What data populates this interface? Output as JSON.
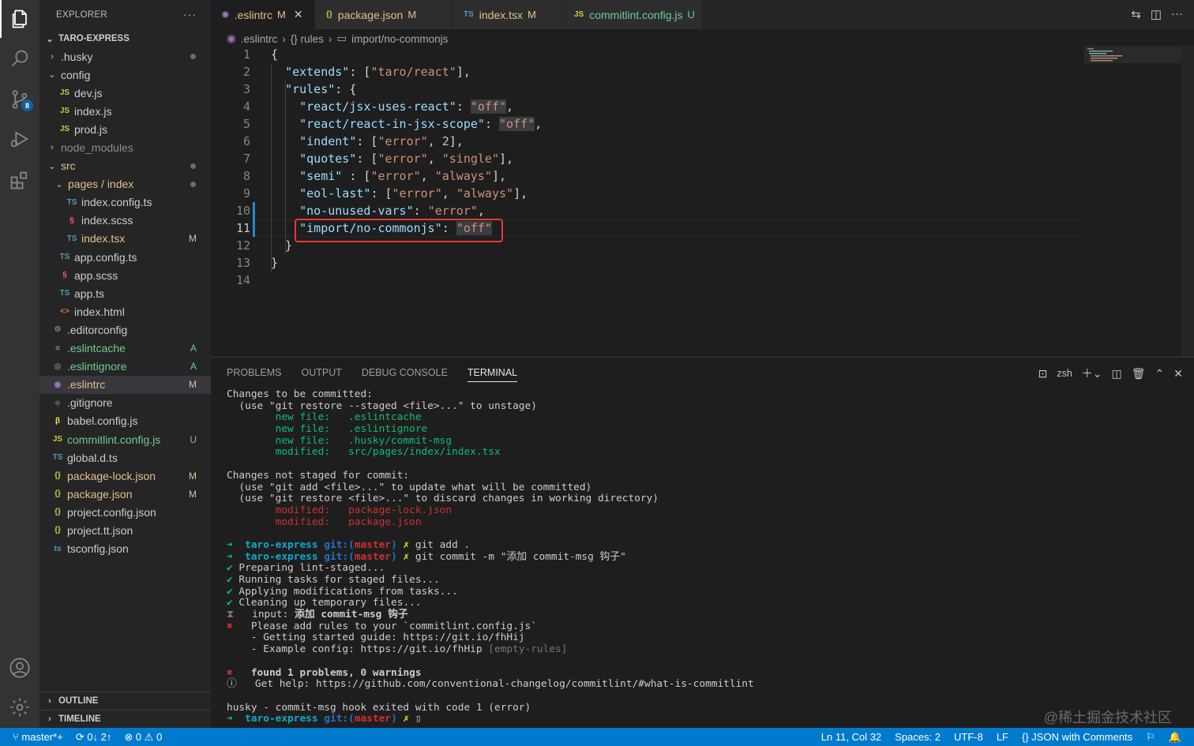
{
  "activity": {
    "scm_badge": "8"
  },
  "sidebar": {
    "title": "EXPLORER",
    "more": "···",
    "root": "TARO-EXPRESS",
    "items": [
      {
        "indent": 1,
        "chev": "›",
        "icon": "",
        "label": ".husky",
        "cls": "flabel",
        "status": "",
        "dot": true
      },
      {
        "indent": 1,
        "chev": "⌄",
        "icon": "",
        "label": "config",
        "cls": "flabel",
        "status": "",
        "dot": false
      },
      {
        "indent": 2,
        "chev": "",
        "icon": "JS",
        "iconcls": "ft-js",
        "label": "dev.js",
        "cls": "flabel",
        "status": ""
      },
      {
        "indent": 2,
        "chev": "",
        "icon": "JS",
        "iconcls": "ft-js",
        "label": "index.js",
        "cls": "flabel",
        "status": ""
      },
      {
        "indent": 2,
        "chev": "",
        "icon": "JS",
        "iconcls": "ft-js",
        "label": "prod.js",
        "cls": "flabel",
        "status": ""
      },
      {
        "indent": 1,
        "chev": "›",
        "icon": "",
        "label": "node_modules",
        "cls": "c-gray",
        "status": ""
      },
      {
        "indent": 1,
        "chev": "⌄",
        "icon": "",
        "label": "src",
        "cls": "c-yellow",
        "status": "",
        "dot": true
      },
      {
        "indent": 2,
        "chev": "⌄",
        "icon": "",
        "label": "pages / index",
        "cls": "c-yellow",
        "status": "",
        "dot": true
      },
      {
        "indent": 3,
        "chev": "",
        "icon": "TS",
        "iconcls": "ft-ts",
        "label": "index.config.ts",
        "cls": "flabel",
        "status": ""
      },
      {
        "indent": 3,
        "chev": "",
        "icon": "§",
        "iconcls": "ft-scss",
        "label": "index.scss",
        "cls": "flabel",
        "status": ""
      },
      {
        "indent": 3,
        "chev": "",
        "icon": "TS",
        "iconcls": "ft-ts",
        "label": "index.tsx",
        "cls": "c-yellow",
        "status": "M",
        "stcls": "c-yellow"
      },
      {
        "indent": 2,
        "chev": "",
        "icon": "TS",
        "iconcls": "ft-ts",
        "label": "app.config.ts",
        "cls": "flabel",
        "status": ""
      },
      {
        "indent": 2,
        "chev": "",
        "icon": "§",
        "iconcls": "ft-scss",
        "label": "app.scss",
        "cls": "flabel",
        "status": ""
      },
      {
        "indent": 2,
        "chev": "",
        "icon": "TS",
        "iconcls": "ft-ts",
        "label": "app.ts",
        "cls": "flabel",
        "status": ""
      },
      {
        "indent": 2,
        "chev": "",
        "icon": "<>",
        "iconcls": "ft-html",
        "label": "index.html",
        "cls": "flabel",
        "status": ""
      },
      {
        "indent": 1,
        "chev": "",
        "icon": "⚙",
        "iconcls": "ft-gear",
        "label": ".editorconfig",
        "cls": "flabel",
        "status": ""
      },
      {
        "indent": 1,
        "chev": "",
        "icon": "≡",
        "iconcls": "ft-lines",
        "label": ".eslintcache",
        "cls": "c-green",
        "status": "A",
        "stcls": "c-green"
      },
      {
        "indent": 1,
        "chev": "",
        "icon": "◎",
        "iconcls": "ft-gear",
        "label": ".eslintignore",
        "cls": "c-green",
        "status": "A",
        "stcls": "c-green"
      },
      {
        "indent": 1,
        "chev": "",
        "icon": "◉",
        "iconcls": "ft-eslint",
        "label": ".eslintrc",
        "cls": "c-yellow",
        "status": "M",
        "stcls": "c-yellow",
        "sel": true
      },
      {
        "indent": 1,
        "chev": "",
        "icon": "◆",
        "iconcls": "ft-git",
        "label": ".gitignore",
        "cls": "flabel",
        "status": ""
      },
      {
        "indent": 1,
        "chev": "",
        "icon": "β",
        "iconcls": "ft-babel",
        "label": "babel.config.js",
        "cls": "flabel",
        "status": ""
      },
      {
        "indent": 1,
        "chev": "",
        "icon": "JS",
        "iconcls": "ft-js",
        "label": "commitlint.config.js",
        "cls": "c-green",
        "status": "U",
        "stcls": "c-green"
      },
      {
        "indent": 1,
        "chev": "",
        "icon": "TS",
        "iconcls": "ft-ts",
        "label": "global.d.ts",
        "cls": "flabel",
        "status": ""
      },
      {
        "indent": 1,
        "chev": "",
        "icon": "{}",
        "iconcls": "ft-json",
        "label": "package-lock.json",
        "cls": "c-yellow",
        "status": "M",
        "stcls": "c-yellow"
      },
      {
        "indent": 1,
        "chev": "",
        "icon": "{}",
        "iconcls": "ft-json",
        "label": "package.json",
        "cls": "c-yellow",
        "status": "M",
        "stcls": "c-yellow"
      },
      {
        "indent": 1,
        "chev": "",
        "icon": "{}",
        "iconcls": "ft-json",
        "label": "project.config.json",
        "cls": "flabel",
        "status": ""
      },
      {
        "indent": 1,
        "chev": "",
        "icon": "{}",
        "iconcls": "ft-json",
        "label": "project.tt.json",
        "cls": "flabel",
        "status": ""
      },
      {
        "indent": 1,
        "chev": "",
        "icon": "ts",
        "iconcls": "ft-tscfg",
        "label": "tsconfig.json",
        "cls": "flabel",
        "status": ""
      }
    ],
    "outline": "OUTLINE",
    "timeline": "TIMELINE"
  },
  "tabs": [
    {
      "icon": "◉",
      "iconcls": "ft-eslint",
      "label": ".eslintrc",
      "status": "M",
      "close": "✕",
      "active": true
    },
    {
      "icon": "{}",
      "iconcls": "ft-json",
      "label": "package.json",
      "status": "M",
      "close": "",
      "active": false
    },
    {
      "icon": "TS",
      "iconcls": "ft-ts",
      "label": "index.tsx",
      "status": "M",
      "close": "",
      "active": false
    },
    {
      "icon": "JS",
      "iconcls": "ft-js",
      "label": "commitlint.config.js",
      "status": "U",
      "close": "",
      "active": false
    }
  ],
  "breadcrumb": {
    "file": ".eslintrc",
    "sep": "›",
    "node1": "{} rules",
    "node2": "import/no-commonjs"
  },
  "editor": {
    "line_numbers": [
      "1",
      "2",
      "3",
      "4",
      "5",
      "6",
      "7",
      "8",
      "9",
      "10",
      "11",
      "12",
      "13",
      "14"
    ],
    "lines": [
      [
        [
          "p",
          "{"
        ]
      ],
      [
        [
          "p",
          "  "
        ],
        [
          "k",
          "\"extends\""
        ],
        [
          "p",
          ": ["
        ],
        [
          "s",
          "\"taro/react\""
        ],
        [
          "p",
          "],"
        ]
      ],
      [
        [
          "p",
          "  "
        ],
        [
          "k",
          "\"rules\""
        ],
        [
          "p",
          ": {"
        ]
      ],
      [
        [
          "p",
          "    "
        ],
        [
          "k",
          "\"react/jsx-uses-react\""
        ],
        [
          "p",
          ": "
        ],
        [
          "sh",
          "\"off\""
        ],
        [
          "p",
          ","
        ]
      ],
      [
        [
          "p",
          "    "
        ],
        [
          "k",
          "\"react/react-in-jsx-scope\""
        ],
        [
          "p",
          ": "
        ],
        [
          "sh",
          "\"off\""
        ],
        [
          "p",
          ","
        ]
      ],
      [
        [
          "p",
          "    "
        ],
        [
          "k",
          "\"indent\""
        ],
        [
          "p",
          ": ["
        ],
        [
          "s",
          "\"error\""
        ],
        [
          "p",
          ", "
        ],
        [
          "n",
          "2"
        ],
        [
          "p",
          "],"
        ]
      ],
      [
        [
          "p",
          "    "
        ],
        [
          "k",
          "\"quotes\""
        ],
        [
          "p",
          ": ["
        ],
        [
          "s",
          "\"error\""
        ],
        [
          "p",
          ", "
        ],
        [
          "s",
          "\"single\""
        ],
        [
          "p",
          "],"
        ]
      ],
      [
        [
          "p",
          "    "
        ],
        [
          "k",
          "\"semi\""
        ],
        [
          "p",
          " : ["
        ],
        [
          "s",
          "\"error\""
        ],
        [
          "p",
          ", "
        ],
        [
          "s",
          "\"always\""
        ],
        [
          "p",
          "],"
        ]
      ],
      [
        [
          "p",
          "    "
        ],
        [
          "k",
          "\"eol-last\""
        ],
        [
          "p",
          ": ["
        ],
        [
          "s",
          "\"error\""
        ],
        [
          "p",
          ", "
        ],
        [
          "s",
          "\"always\""
        ],
        [
          "p",
          "],"
        ]
      ],
      [
        [
          "p",
          "    "
        ],
        [
          "k",
          "\"no-unused-vars\""
        ],
        [
          "p",
          ": "
        ],
        [
          "s",
          "\"error\""
        ],
        [
          "p",
          ","
        ]
      ],
      [
        [
          "p",
          "    "
        ],
        [
          "k",
          "\"import/no-commonjs\""
        ],
        [
          "p",
          ": "
        ],
        [
          "sh",
          "\"off\""
        ]
      ],
      [
        [
          "p",
          "  }"
        ]
      ],
      [
        [
          "p",
          "}"
        ]
      ],
      [
        [
          "p",
          ""
        ]
      ]
    ]
  },
  "panel": {
    "tabs": [
      "PROBLEMS",
      "OUTPUT",
      "DEBUG CONSOLE",
      "TERMINAL"
    ],
    "active_tab": "TERMINAL",
    "shell": "zsh",
    "terminal": [
      [
        [
          "",
          "Changes to be committed:"
        ]
      ],
      [
        [
          "",
          "  (use \"git restore --staged <file>...\" to unstage)"
        ]
      ],
      [
        [
          "t-green",
          "        new file:   .eslintcache"
        ]
      ],
      [
        [
          "t-green",
          "        new file:   .eslintignore"
        ]
      ],
      [
        [
          "t-green",
          "        new file:   .husky/commit-msg"
        ]
      ],
      [
        [
          "t-green",
          "        modified:   src/pages/index/index.tsx"
        ]
      ],
      [
        [
          "",
          ""
        ]
      ],
      [
        [
          "",
          "Changes not staged for commit:"
        ]
      ],
      [
        [
          "",
          "  (use \"git add <file>...\" to update what will be committed)"
        ]
      ],
      [
        [
          "",
          "  (use \"git restore <file>...\" to discard changes in working directory)"
        ]
      ],
      [
        [
          "t-red",
          "        modified:   package-lock.json"
        ]
      ],
      [
        [
          "t-red",
          "        modified:   package.json"
        ]
      ],
      [
        [
          "",
          ""
        ]
      ],
      [
        [
          "t-green",
          "➜  "
        ],
        [
          "t-cyan t-bold",
          "taro-express "
        ],
        [
          "t-blue t-bold",
          "git:("
        ],
        [
          "t-red t-bold",
          "master"
        ],
        [
          "t-blue t-bold",
          ") "
        ],
        [
          "t-yellow",
          "✗ "
        ],
        [
          "",
          "git add ."
        ]
      ],
      [
        [
          "t-green",
          "➜  "
        ],
        [
          "t-cyan t-bold",
          "taro-express "
        ],
        [
          "t-blue t-bold",
          "git:("
        ],
        [
          "t-red t-bold",
          "master"
        ],
        [
          "t-blue t-bold",
          ") "
        ],
        [
          "t-yellow",
          "✗ "
        ],
        [
          "",
          "git commit -m \"添加 commit-msg 钩子\""
        ]
      ],
      [
        [
          "t-green",
          "✔ "
        ],
        [
          "",
          "Preparing lint-staged..."
        ]
      ],
      [
        [
          "t-green",
          "✔ "
        ],
        [
          "",
          "Running tasks for staged files..."
        ]
      ],
      [
        [
          "t-green",
          "✔ "
        ],
        [
          "",
          "Applying modifications from tasks..."
        ]
      ],
      [
        [
          "t-green",
          "✔ "
        ],
        [
          "",
          "Cleaning up temporary files..."
        ]
      ],
      [
        [
          "t-gray",
          "⧗ "
        ],
        [
          "",
          "  input: "
        ],
        [
          "t-bold",
          "添加 commit-msg 钩子"
        ]
      ],
      [
        [
          "t-red",
          "✖ "
        ],
        [
          "",
          "  Please add rules to your `commitlint.config.js`"
        ]
      ],
      [
        [
          "",
          "    - Getting started guide: https://git.io/fhHij"
        ]
      ],
      [
        [
          "",
          "    - Example config: https://git.io/fhHip "
        ],
        [
          "t-gray",
          "[empty-rules]"
        ]
      ],
      [
        [
          "",
          ""
        ]
      ],
      [
        [
          "t-red",
          "✖ "
        ],
        [
          "t-bold",
          "  found 1 problems, 0 warnings"
        ]
      ],
      [
        [
          "",
          "ⓘ   Get help: https://github.com/conventional-changelog/commitlint/#what-is-commitlint"
        ]
      ],
      [
        [
          "",
          ""
        ]
      ],
      [
        [
          "",
          "husky - commit-msg hook exited with code 1 (error)"
        ]
      ],
      [
        [
          "t-green",
          "➜  "
        ],
        [
          "t-cyan t-bold",
          "taro-express "
        ],
        [
          "t-blue t-bold",
          "git:("
        ],
        [
          "t-red t-bold",
          "master"
        ],
        [
          "t-blue t-bold",
          ") "
        ],
        [
          "t-yellow",
          "✗ "
        ],
        [
          "",
          "▯"
        ]
      ]
    ]
  },
  "watermark": "@稀土掘金技术社区",
  "statusbar": {
    "branch": "master*+",
    "sync": "0↓ 2↑",
    "errors": "0",
    "warnings": "0",
    "position": "Ln 11, Col 32",
    "spaces": "Spaces: 2",
    "encoding": "UTF-8",
    "eol": "LF",
    "language": "{} JSON with Comments"
  }
}
